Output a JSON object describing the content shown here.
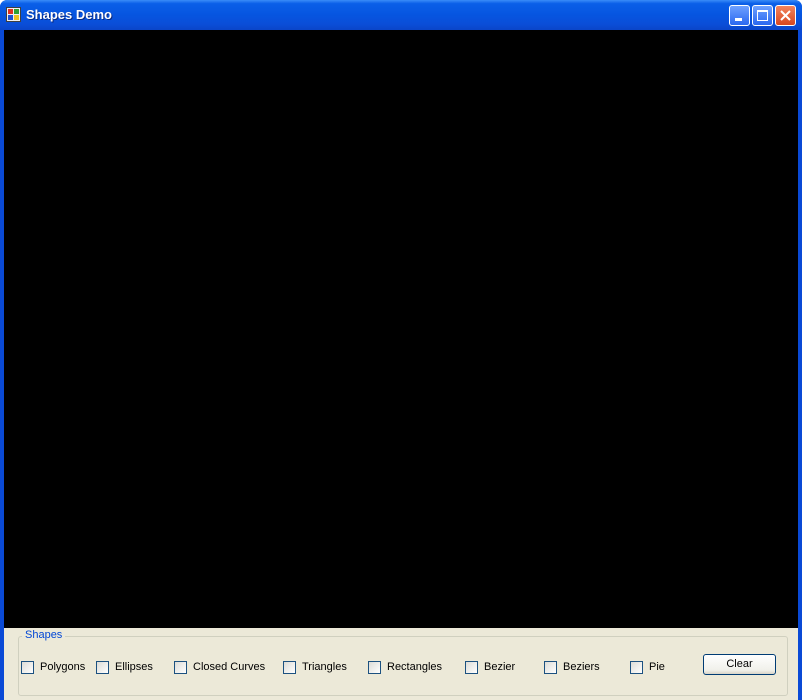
{
  "window": {
    "title": "Shapes Demo",
    "icon": "app-icon",
    "controls": [
      "minimize-icon",
      "maximize-icon",
      "close-icon"
    ]
  },
  "colors": {
    "titlebar": "#0a5fe8",
    "canvas": "#000000",
    "panel": "#ece9d8",
    "group_label": "#0046d5"
  },
  "shapes_group": {
    "label": "Shapes",
    "checkboxes": [
      {
        "label": "Polygons",
        "checked": false
      },
      {
        "label": "Ellipses",
        "checked": false
      },
      {
        "label": "Closed Curves",
        "checked": false
      },
      {
        "label": "Triangles",
        "checked": false
      },
      {
        "label": "Rectangles",
        "checked": false
      },
      {
        "label": "Bezier",
        "checked": false
      },
      {
        "label": "Beziers",
        "checked": false
      },
      {
        "label": "Pie",
        "checked": false
      }
    ],
    "clear_label": "Clear"
  }
}
